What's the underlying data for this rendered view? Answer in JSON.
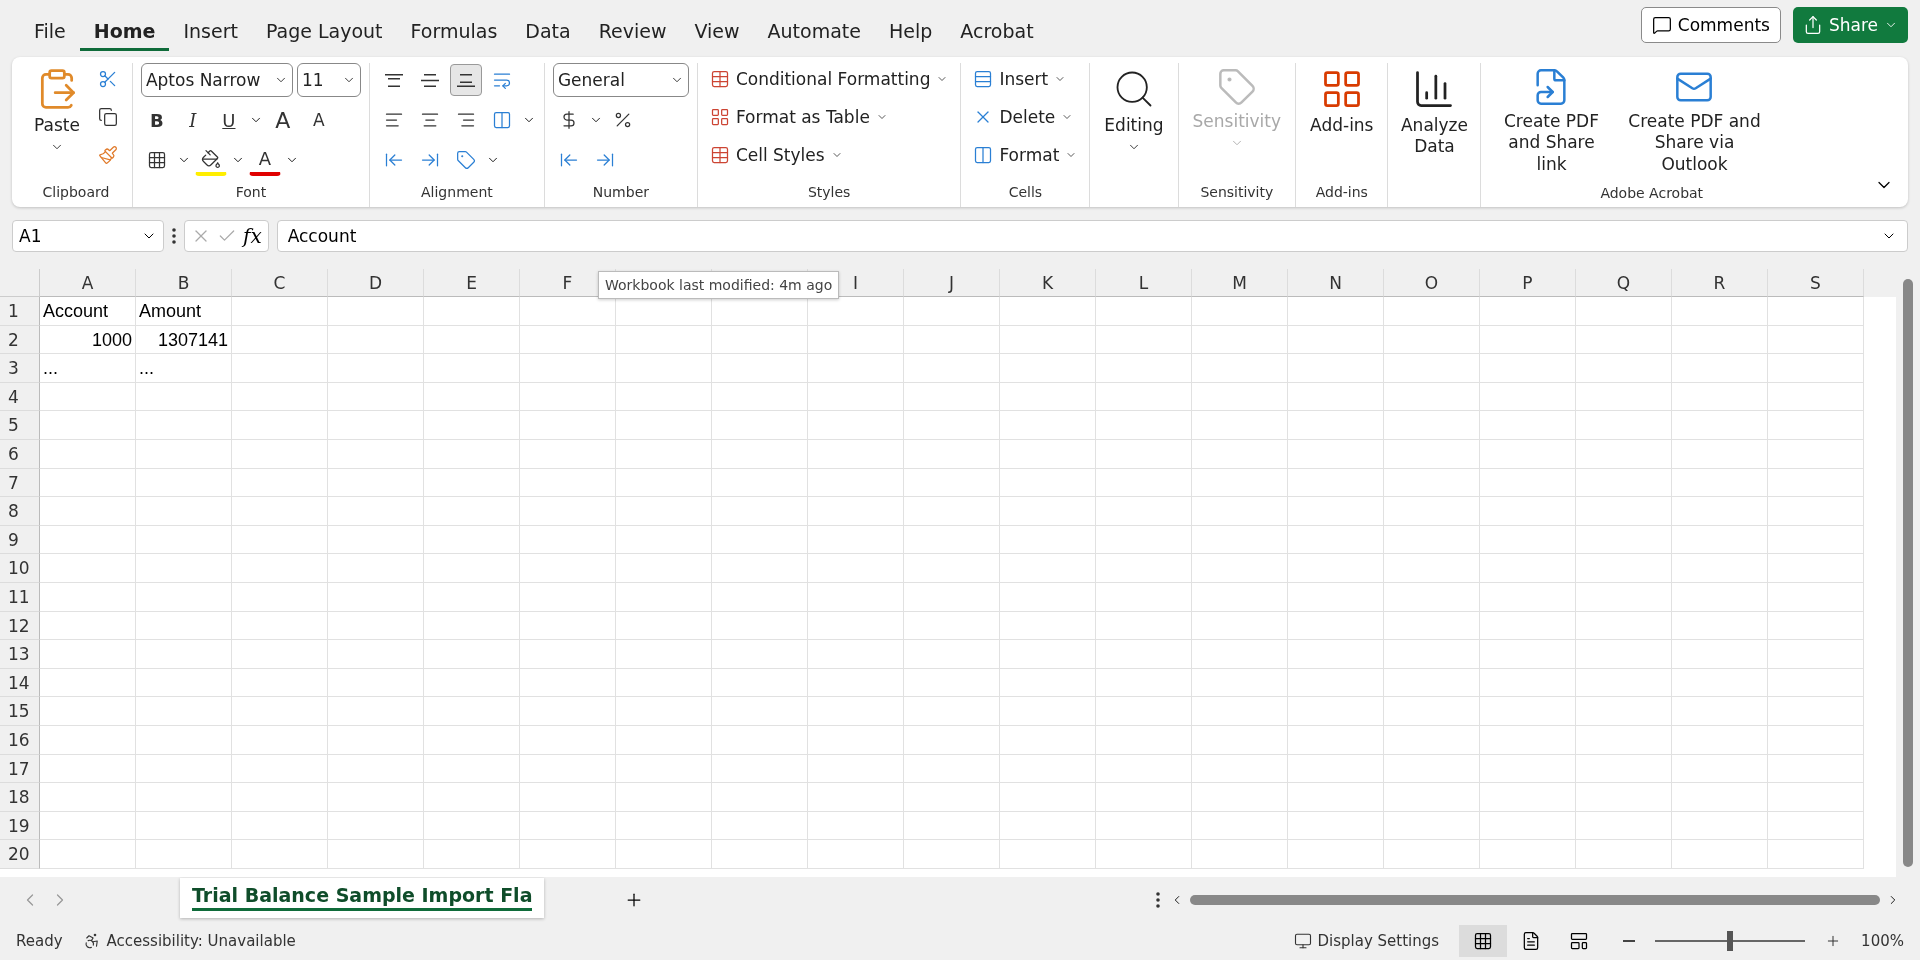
{
  "menu_tabs": [
    {
      "label": "File",
      "selected": false
    },
    {
      "label": "Home",
      "selected": true
    },
    {
      "label": "Insert",
      "selected": false
    },
    {
      "label": "Page Layout",
      "selected": false
    },
    {
      "label": "Formulas",
      "selected": false
    },
    {
      "label": "Data",
      "selected": false
    },
    {
      "label": "Review",
      "selected": false
    },
    {
      "label": "View",
      "selected": false
    },
    {
      "label": "Automate",
      "selected": false
    },
    {
      "label": "Help",
      "selected": false
    },
    {
      "label": "Acrobat",
      "selected": false
    }
  ],
  "header_buttons": {
    "comments": "Comments",
    "share": "Share"
  },
  "ribbon": {
    "clipboard": {
      "paste": "Paste",
      "label": "Clipboard"
    },
    "font": {
      "font_name": "Aptos Narrow",
      "font_size": "11",
      "bold": "B",
      "italic": "I",
      "underline": "U",
      "grow": "A",
      "shrink": "A",
      "font_color": "A",
      "label": "Font"
    },
    "alignment": {
      "vertical": [
        {
          "selected": false
        },
        {
          "selected": false
        },
        {
          "selected": true
        }
      ],
      "label": "Alignment"
    },
    "number": {
      "format": "General",
      "label": "Number"
    },
    "styles": {
      "items": [
        "Conditional Formatting",
        "Format as Table",
        "Cell Styles"
      ],
      "label": "Styles"
    },
    "cells": {
      "items": [
        "Insert",
        "Delete",
        "Format"
      ],
      "label": "Cells"
    },
    "editing": {
      "button": "Editing"
    },
    "sensitivity": {
      "button": "Sensitivity",
      "disabled": true,
      "label": "Sensitivity"
    },
    "addins": {
      "button": "Add-ins",
      "label": "Add-ins"
    },
    "analyze": {
      "button": "Analyze Data"
    },
    "acrobat": {
      "buttons": [
        "Create PDF and Share link",
        "Create PDF and Share via Outlook"
      ],
      "label": "Adobe Acrobat"
    }
  },
  "formula_bar": {
    "name_box": "A1",
    "function_label": "fx",
    "formula": "Account"
  },
  "tooltip": "Workbook last modified: 4m ago",
  "sheet": {
    "columns": [
      {
        "label": "A"
      },
      {
        "label": "B"
      },
      {
        "label": "C"
      },
      {
        "label": "D"
      },
      {
        "label": "E"
      },
      {
        "label": "F"
      },
      {},
      {},
      {
        "label": "I"
      },
      {
        "label": "J"
      },
      {
        "label": "K"
      },
      {
        "label": "L"
      },
      {
        "label": "M"
      },
      {
        "label": "N"
      },
      {
        "label": "O"
      },
      {
        "label": "P"
      },
      {
        "label": "Q"
      },
      {
        "label": "R"
      },
      {
        "label": "S"
      }
    ],
    "rows": [
      {
        "number": "1",
        "cells": [
          {
            "text": "Account",
            "kind": "text"
          },
          {
            "text": "Amount",
            "kind": "text"
          }
        ]
      },
      {
        "number": "2",
        "cells": [
          {
            "text": "1000",
            "kind": "number"
          },
          {
            "text": "1307141",
            "kind": "number"
          }
        ]
      },
      {
        "number": "3",
        "cells": [
          {
            "text": "...",
            "kind": "text"
          },
          {
            "text": "...",
            "kind": "text"
          }
        ]
      },
      {
        "number": "4"
      },
      {
        "number": "5"
      },
      {
        "number": "6"
      },
      {
        "number": "7"
      },
      {
        "number": "8"
      },
      {
        "number": "9"
      },
      {
        "number": "10"
      },
      {
        "number": "11"
      },
      {
        "number": "12"
      },
      {
        "number": "13"
      },
      {
        "number": "14"
      },
      {
        "number": "15"
      },
      {
        "number": "16"
      },
      {
        "number": "17"
      },
      {
        "number": "18"
      },
      {
        "number": "19"
      },
      {
        "number": "20"
      }
    ]
  },
  "sheet_tabs": [
    {
      "label": "Trial Balance Sample Import Fla",
      "selected": true
    }
  ],
  "status_bar": {
    "mode": "Ready",
    "accessibility": "Accessibility: Unavailable",
    "display_settings": "Display Settings",
    "views": [
      {
        "selected": true
      },
      {
        "selected": false
      },
      {
        "selected": false
      }
    ],
    "zoom_slider": {
      "level": 0.5
    },
    "zoom": "100%"
  }
}
